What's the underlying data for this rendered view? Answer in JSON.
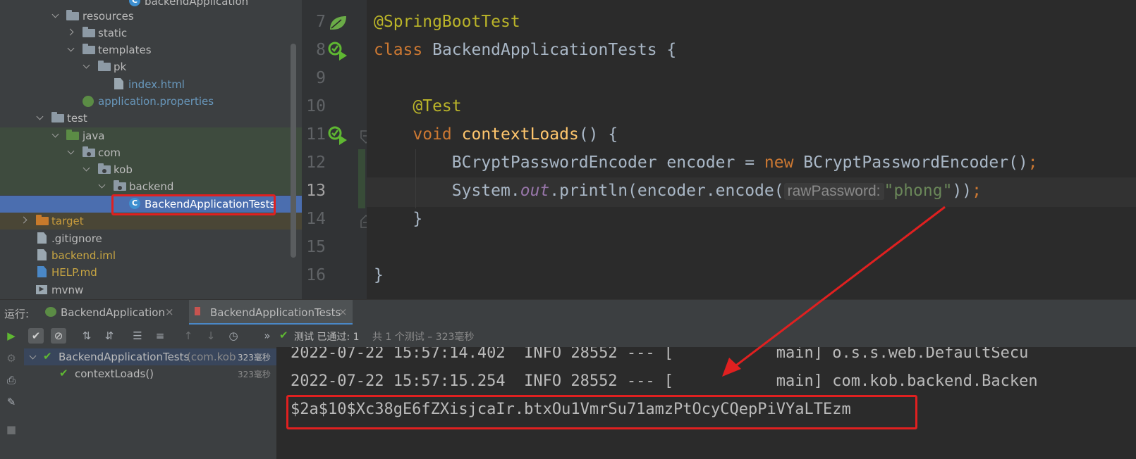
{
  "project_tree": {
    "items": [
      {
        "label": "backendApplication",
        "color": "#bbbbbb"
      },
      {
        "label": "resources",
        "color": "#bbbbbb"
      },
      {
        "label": "static",
        "color": "#bbbbbb"
      },
      {
        "label": "templates",
        "color": "#bbbbbb"
      },
      {
        "label": "pk",
        "color": "#bbbbbb"
      },
      {
        "label": "index.html",
        "color": "#6897bb"
      },
      {
        "label": "application.properties",
        "color": "#6897bb"
      },
      {
        "label": "test",
        "color": "#bbbbbb"
      },
      {
        "label": "java",
        "color": "#bbbbbb"
      },
      {
        "label": "com",
        "color": "#bbbbbb"
      },
      {
        "label": "kob",
        "color": "#bbbbbb"
      },
      {
        "label": "backend",
        "color": "#bbbbbb"
      },
      {
        "label": "BackendApplicationTests",
        "color": "#ffffff"
      },
      {
        "label": "target",
        "color": "#c79a3c"
      },
      {
        "label": ".gitignore",
        "color": "#bbbbbb"
      },
      {
        "label": "backend.iml",
        "color": "#c7a542"
      },
      {
        "label": "HELP.md",
        "color": "#c7a542"
      },
      {
        "label": "mvnw",
        "color": "#bbbbbb"
      }
    ]
  },
  "editor": {
    "line_numbers": [
      "7",
      "8",
      "9",
      "10",
      "11",
      "12",
      "13",
      "14",
      "15",
      "16"
    ],
    "annotation_springboottest": "@SpringBootTest",
    "kw_class": "class",
    "class_decl": " BackendApplicationTests {",
    "annotation_test": "@Test",
    "kw_void": "void",
    "method_name": "contextLoads",
    "method_tail": "() {",
    "line12_type": "BCryptPasswordEncoder encoder = ",
    "kw_new": "new",
    "line12_ctor": " BCryptPasswordEncoder()",
    "semicolon": ";",
    "line13_system": "System.",
    "line13_out": "out",
    "line13_call": ".println(encoder.encode(",
    "param_hint": "rawPassword:",
    "string_arg": "\"phong\"",
    "line13_close": "))",
    "close_brace_inner": "}",
    "close_brace_outer": "}"
  },
  "run_panel": {
    "label": "运行:",
    "tabs": [
      {
        "label": "BackendApplication"
      },
      {
        "label": "BackendApplicationTests"
      }
    ],
    "status_prefix": "测试 已通过: 1",
    "status_suffix": "共 1 个测试 – 323毫秒",
    "test_tree": [
      {
        "label": "BackendApplicationTests",
        "sub": "(com.kob",
        "time": "323毫秒"
      },
      {
        "label": "contextLoads()",
        "time": "323毫秒"
      }
    ],
    "console_lines": [
      "2022-07-22 15:57:14.402  INFO 28552 --- [           main] o.s.s.web.DefaultSecu",
      "2022-07-22 15:57:15.254  INFO 28552 --- [           main] com.kob.backend.Backen",
      "$2a$10$Xc38gE6fZXisjcaIr.btxOu1VmrSu71amzPtOcyCQepPiVYaLTEzm"
    ]
  },
  "colors": {
    "highlight_red": "#e02020",
    "pass_green": "#5fb832",
    "selection_blue": "#4b6eaf"
  }
}
